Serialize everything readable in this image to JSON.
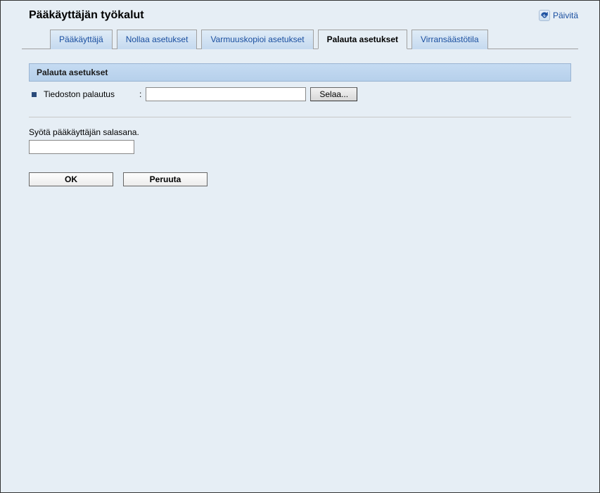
{
  "header": {
    "title": "Pääkäyttäjän työkalut",
    "refresh_label": "Päivitä"
  },
  "tabs": [
    {
      "label": "Pääkäyttäjä"
    },
    {
      "label": "Nollaa asetukset"
    },
    {
      "label": "Varmuuskopioi asetukset"
    },
    {
      "label": "Palauta asetukset"
    },
    {
      "label": "Virransäästötila"
    }
  ],
  "section": {
    "title": "Palauta asetukset",
    "file_label": "Tiedoston palautus",
    "colon": ":",
    "file_value": "",
    "browse_label": "Selaa..."
  },
  "password": {
    "prompt": "Syötä pääkäyttäjän salasana.",
    "value": ""
  },
  "buttons": {
    "ok": "OK",
    "cancel": "Peruuta"
  }
}
